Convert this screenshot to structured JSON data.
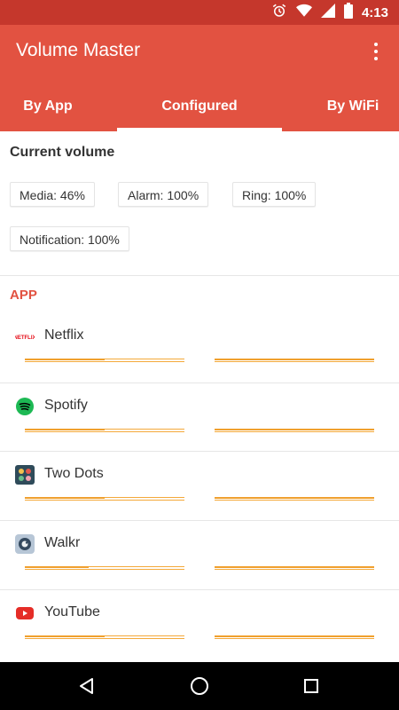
{
  "status_bar": {
    "time": "4:13"
  },
  "app_bar": {
    "title": "Volume Master"
  },
  "tabs": [
    {
      "label": "By App",
      "selected": false
    },
    {
      "label": "Configured",
      "selected": true
    },
    {
      "label": "By WiFi",
      "selected": false
    }
  ],
  "current_volume": {
    "title": "Current volume",
    "chips": {
      "media": "Media: 46%",
      "alarm": "Alarm: 100%",
      "ring": "Ring: 100%",
      "notification": "Notification: 100%"
    }
  },
  "section": {
    "label": "APP"
  },
  "apps": [
    {
      "name": "Netflix",
      "icon": "netflix-icon",
      "volume_left": 0.5,
      "volume_right": 1.0
    },
    {
      "name": "Spotify",
      "icon": "spotify-icon",
      "volume_left": 0.5,
      "volume_right": 1.0
    },
    {
      "name": "Two Dots",
      "icon": "two-dots-icon",
      "volume_left": 0.5,
      "volume_right": 1.0
    },
    {
      "name": "Walkr",
      "icon": "walkr-icon",
      "volume_left": 0.4,
      "volume_right": 1.0
    },
    {
      "name": "YouTube",
      "icon": "youtube-icon",
      "volume_left": 0.5,
      "volume_right": 1.0
    }
  ],
  "colors": {
    "primary": "#E25241",
    "primary_dark": "#C5372C",
    "slider": "#F4A93A"
  }
}
